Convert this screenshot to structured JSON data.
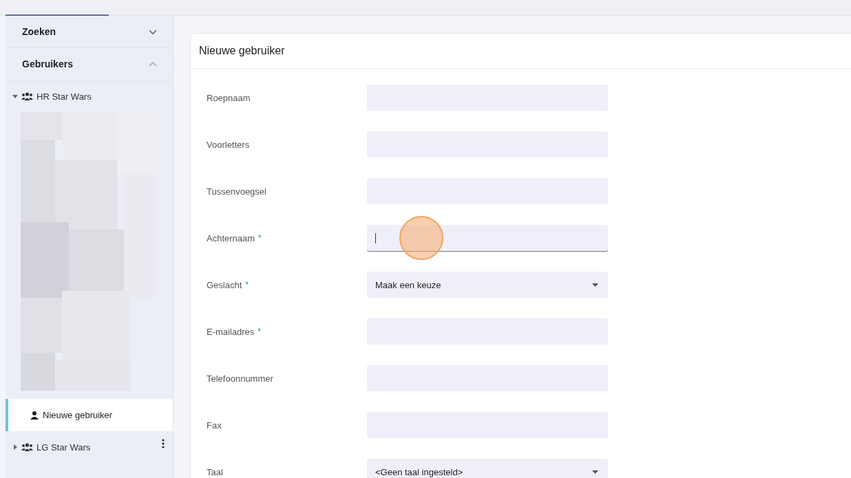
{
  "sidebar": {
    "sections": [
      {
        "title": "Zoeken",
        "expanded": false
      },
      {
        "title": "Gebruikers",
        "expanded": true
      }
    ],
    "groups": [
      {
        "name": "HR Star Wars",
        "expanded": true,
        "children": [
          {
            "kind": "blurred"
          },
          {
            "kind": "item",
            "name": "Nieuwe gebruiker",
            "selected": true
          }
        ]
      },
      {
        "name": "LG Star Wars",
        "expanded": false
      }
    ]
  },
  "form": {
    "title": "Nieuwe gebruiker",
    "fields": [
      {
        "label": "Roepnaam",
        "kind": "text",
        "focused": false
      },
      {
        "label": "Voorletters",
        "kind": "text",
        "focused": false
      },
      {
        "label": "Tussenvoegsel",
        "kind": "text",
        "focused": false
      },
      {
        "label": "Achternaam",
        "required_mark": "*",
        "kind": "text",
        "focused": true
      },
      {
        "label": "Geslacht",
        "required_mark": "*",
        "kind": "select",
        "value": "Maak een keuze",
        "focused": false
      },
      {
        "label": "E-mailadres",
        "required_mark": "*",
        "kind": "text",
        "focused": false
      },
      {
        "label": "Telefoonnummer",
        "kind": "text",
        "focused": false
      },
      {
        "label": "Fax",
        "kind": "text",
        "focused": false
      },
      {
        "label": "Taal",
        "kind": "select",
        "value": "<Geen taal ingesteld>",
        "focused": false
      }
    ]
  }
}
